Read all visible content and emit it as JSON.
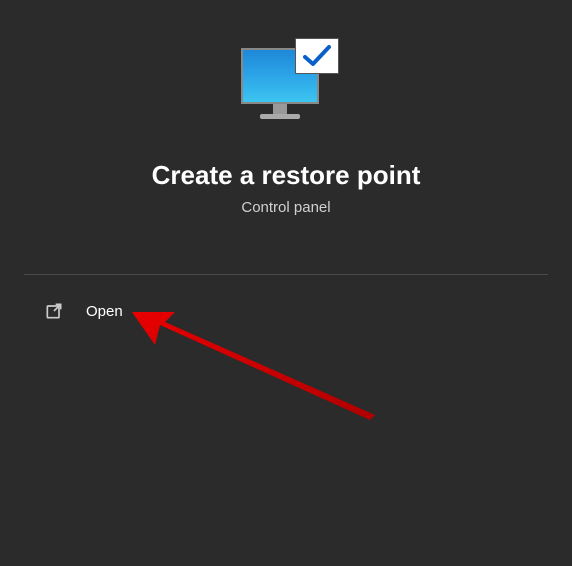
{
  "header": {
    "title": "Create a restore point",
    "subtitle": "Control panel"
  },
  "actions": {
    "open_label": "Open"
  },
  "icons": {
    "app_icon": "monitor-check-icon",
    "open_icon": "external-link-icon"
  },
  "colors": {
    "background": "#2b2b2b",
    "text_primary": "#ffffff",
    "text_secondary": "#d0d0d0",
    "divider": "#4a4a4a",
    "monitor_gradient_top": "#1e88d8",
    "monitor_gradient_bottom": "#3cc5f0",
    "check_color": "#0a5fc9",
    "arrow_color": "#d40000"
  }
}
